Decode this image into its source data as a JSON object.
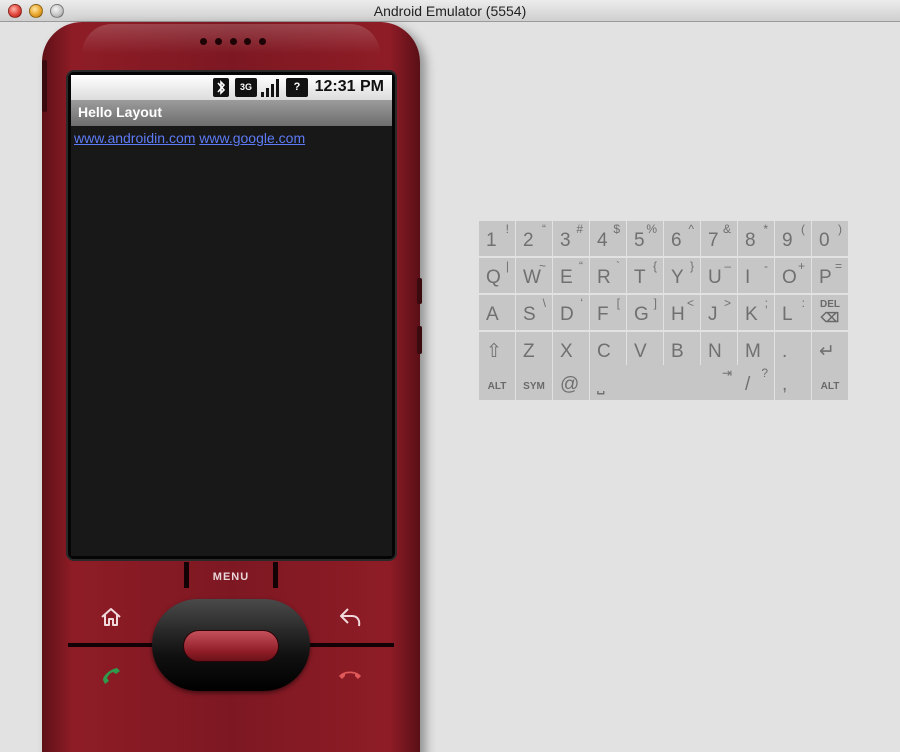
{
  "window": {
    "title": "Android Emulator (5554)"
  },
  "status_bar": {
    "time": "12:31 PM",
    "icons": [
      "bluetooth-icon",
      "3g-icon",
      "signal-icon",
      "battery-unknown-icon"
    ]
  },
  "app": {
    "title": "Hello Layout",
    "links": [
      "www.androidin.com",
      "www.google.com"
    ]
  },
  "hardware": {
    "menu_label": "MENU"
  },
  "keyboard": {
    "rows": [
      [
        {
          "k": "1",
          "a": "!"
        },
        {
          "k": "2",
          "a": "“"
        },
        {
          "k": "3",
          "a": "#"
        },
        {
          "k": "4",
          "a": "$"
        },
        {
          "k": "5",
          "a": "%"
        },
        {
          "k": "6",
          "a": "^"
        },
        {
          "k": "7",
          "a": "&"
        },
        {
          "k": "8",
          "a": "*"
        },
        {
          "k": "9",
          "a": "("
        },
        {
          "k": "0",
          "a": ")"
        }
      ],
      [
        {
          "k": "Q",
          "a": "|"
        },
        {
          "k": "W",
          "a": "~"
        },
        {
          "k": "E",
          "a": "“"
        },
        {
          "k": "R",
          "a": "`"
        },
        {
          "k": "T",
          "a": "{"
        },
        {
          "k": "Y",
          "a": "}"
        },
        {
          "k": "U",
          "a": "–"
        },
        {
          "k": "I",
          "a": "-"
        },
        {
          "k": "O",
          "a": "+"
        },
        {
          "k": "P",
          "a": "="
        }
      ],
      [
        {
          "k": "A",
          "a": ""
        },
        {
          "k": "S",
          "a": "\\"
        },
        {
          "k": "D",
          "a": "‘"
        },
        {
          "k": "F",
          "a": "["
        },
        {
          "k": "G",
          "a": "]"
        },
        {
          "k": "H",
          "a": "<"
        },
        {
          "k": "J",
          "a": ">"
        },
        {
          "k": "K",
          "a": ";"
        },
        {
          "k": "L",
          "a": ":"
        },
        {
          "k": "DEL",
          "a": "⌫"
        }
      ],
      [
        {
          "k": "⇧",
          "a": ""
        },
        {
          "k": "Z",
          "a": ""
        },
        {
          "k": "X",
          "a": ""
        },
        {
          "k": "C",
          "a": ""
        },
        {
          "k": "V",
          "a": ""
        },
        {
          "k": "B",
          "a": ""
        },
        {
          "k": "N",
          "a": ""
        },
        {
          "k": "M",
          "a": ""
        },
        {
          "k": ".",
          "a": ""
        },
        {
          "k": "↵",
          "a": ""
        }
      ],
      [
        {
          "k": "ALT",
          "a": ""
        },
        {
          "k": "SYM",
          "a": ""
        },
        {
          "k": "@",
          "a": ""
        },
        {
          "k": "⎵",
          "a": "⇥"
        },
        {
          "k": "/",
          "a": "?"
        },
        {
          "k": ",",
          "a": ""
        },
        {
          "k": "ALT",
          "a": ""
        }
      ]
    ]
  }
}
